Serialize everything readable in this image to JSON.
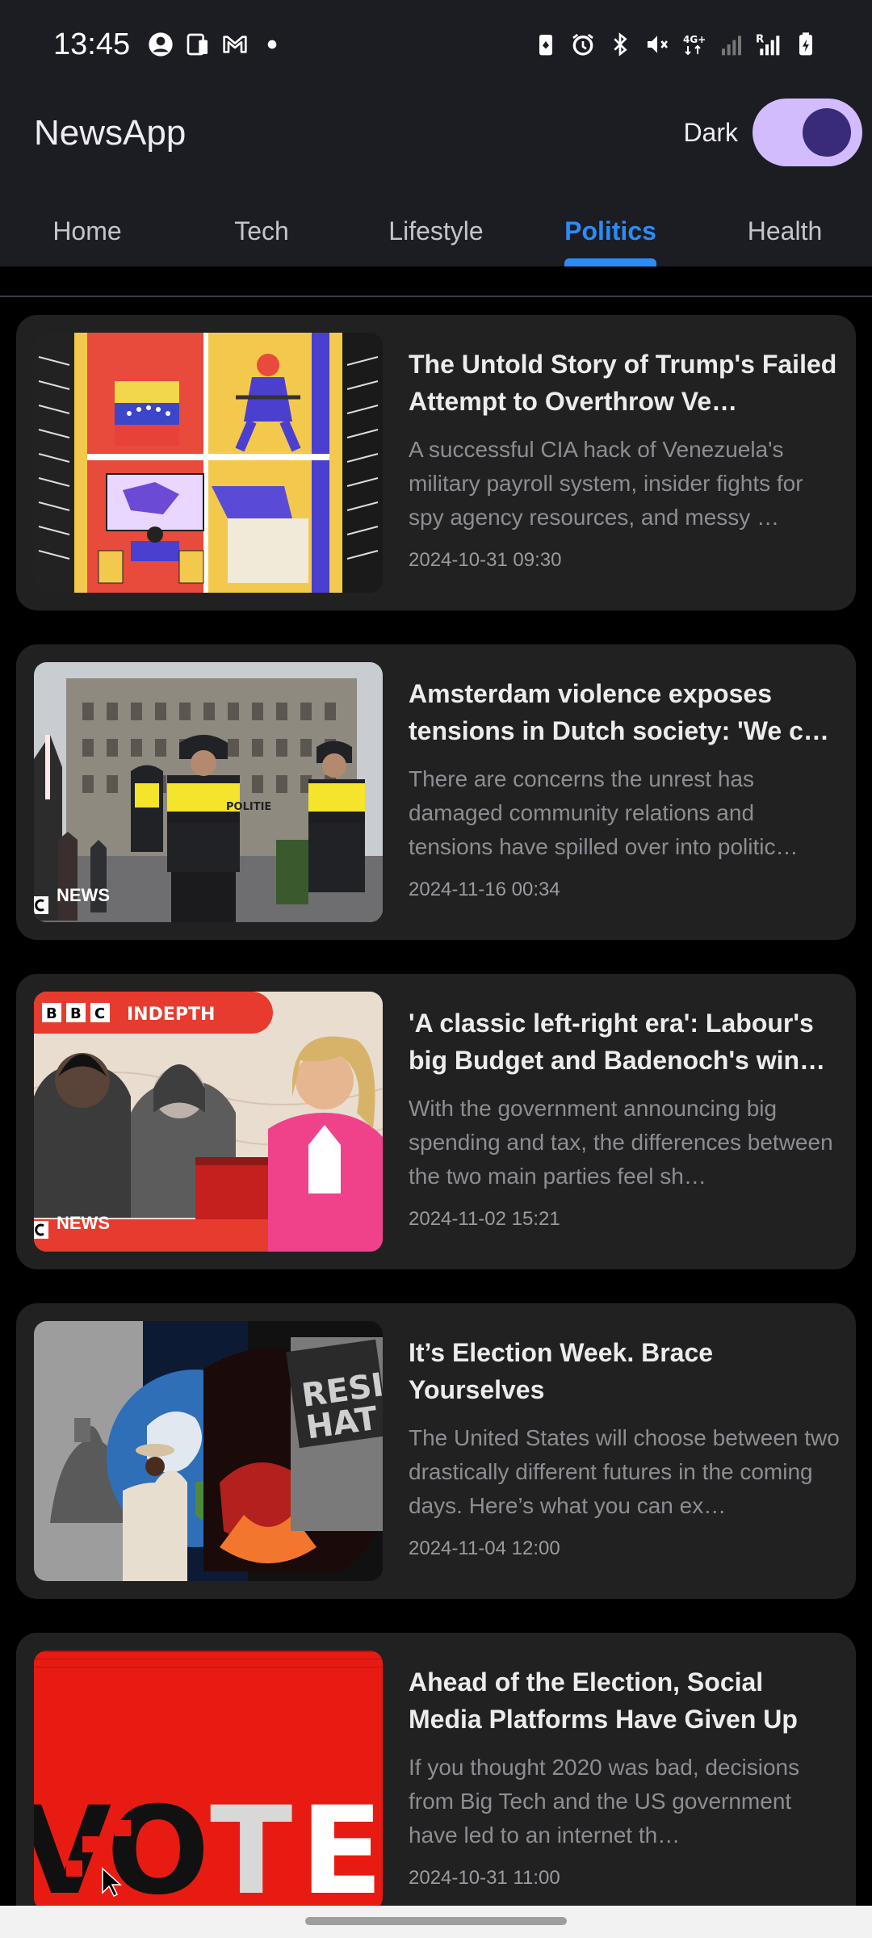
{
  "status_bar": {
    "time": "13:45",
    "left_icons": [
      "account-circle-icon",
      "device-icon",
      "gmail-icon",
      "dot-icon"
    ],
    "right_icons": [
      "battery-saver-icon",
      "alarm-icon",
      "bluetooth-icon",
      "mute-icon",
      "4g-icon",
      "signal-icon",
      "signal-roaming-icon",
      "battery-icon"
    ],
    "network_label": "4G+",
    "roaming_label": "R"
  },
  "app_bar": {
    "title": "NewsApp",
    "theme_label": "Dark",
    "theme_on": true
  },
  "tabs": [
    {
      "label": "Home",
      "active": false
    },
    {
      "label": "Tech",
      "active": false
    },
    {
      "label": "Lifestyle",
      "active": false
    },
    {
      "label": "Politics",
      "active": true
    },
    {
      "label": "Health",
      "active": false
    }
  ],
  "articles": [
    {
      "title": "The Untold Story of Trump's Failed Attempt to Overthrow Ve…",
      "summary": "A successful CIA hack of Venezuela's military payroll system, insider fights for spy agency resources, and messy …",
      "date": "2024-10-31 09:30",
      "image_label": ""
    },
    {
      "title": "Amsterdam violence exposes tensions in Dutch society: 'We c…",
      "summary": "There are concerns the unrest has damaged community relations and tensions have spilled over into politic…",
      "date": "2024-11-16 00:34",
      "image_label": "NEWS",
      "image_sign": "POLITIE"
    },
    {
      "title": "'A classic left-right era': Labour's big Budget and Badenoch's win r…",
      "summary": "With the government announcing big spending and tax, the differences between the two main parties feel sh…",
      "date": "2024-11-02 15:21",
      "image_label": "NEWS",
      "image_badge": "INDEPTH",
      "image_logo": "BBC"
    },
    {
      "title": "It’s Election Week. Brace Yourselves",
      "summary": "The United States will choose between two drastically different futures in the coming days. Here’s what you can ex…",
      "date": "2024-11-04 12:00",
      "image_label": "",
      "image_sign": "RESI HAT"
    },
    {
      "title": "Ahead of the Election, Social Media Platforms Have Given Up",
      "summary": "If you thought 2020 was bad, decisions from Big Tech and the US government have led to an internet th…",
      "date": "2024-10-31 11:00",
      "image_label": "",
      "image_word": "VOTE"
    }
  ]
}
